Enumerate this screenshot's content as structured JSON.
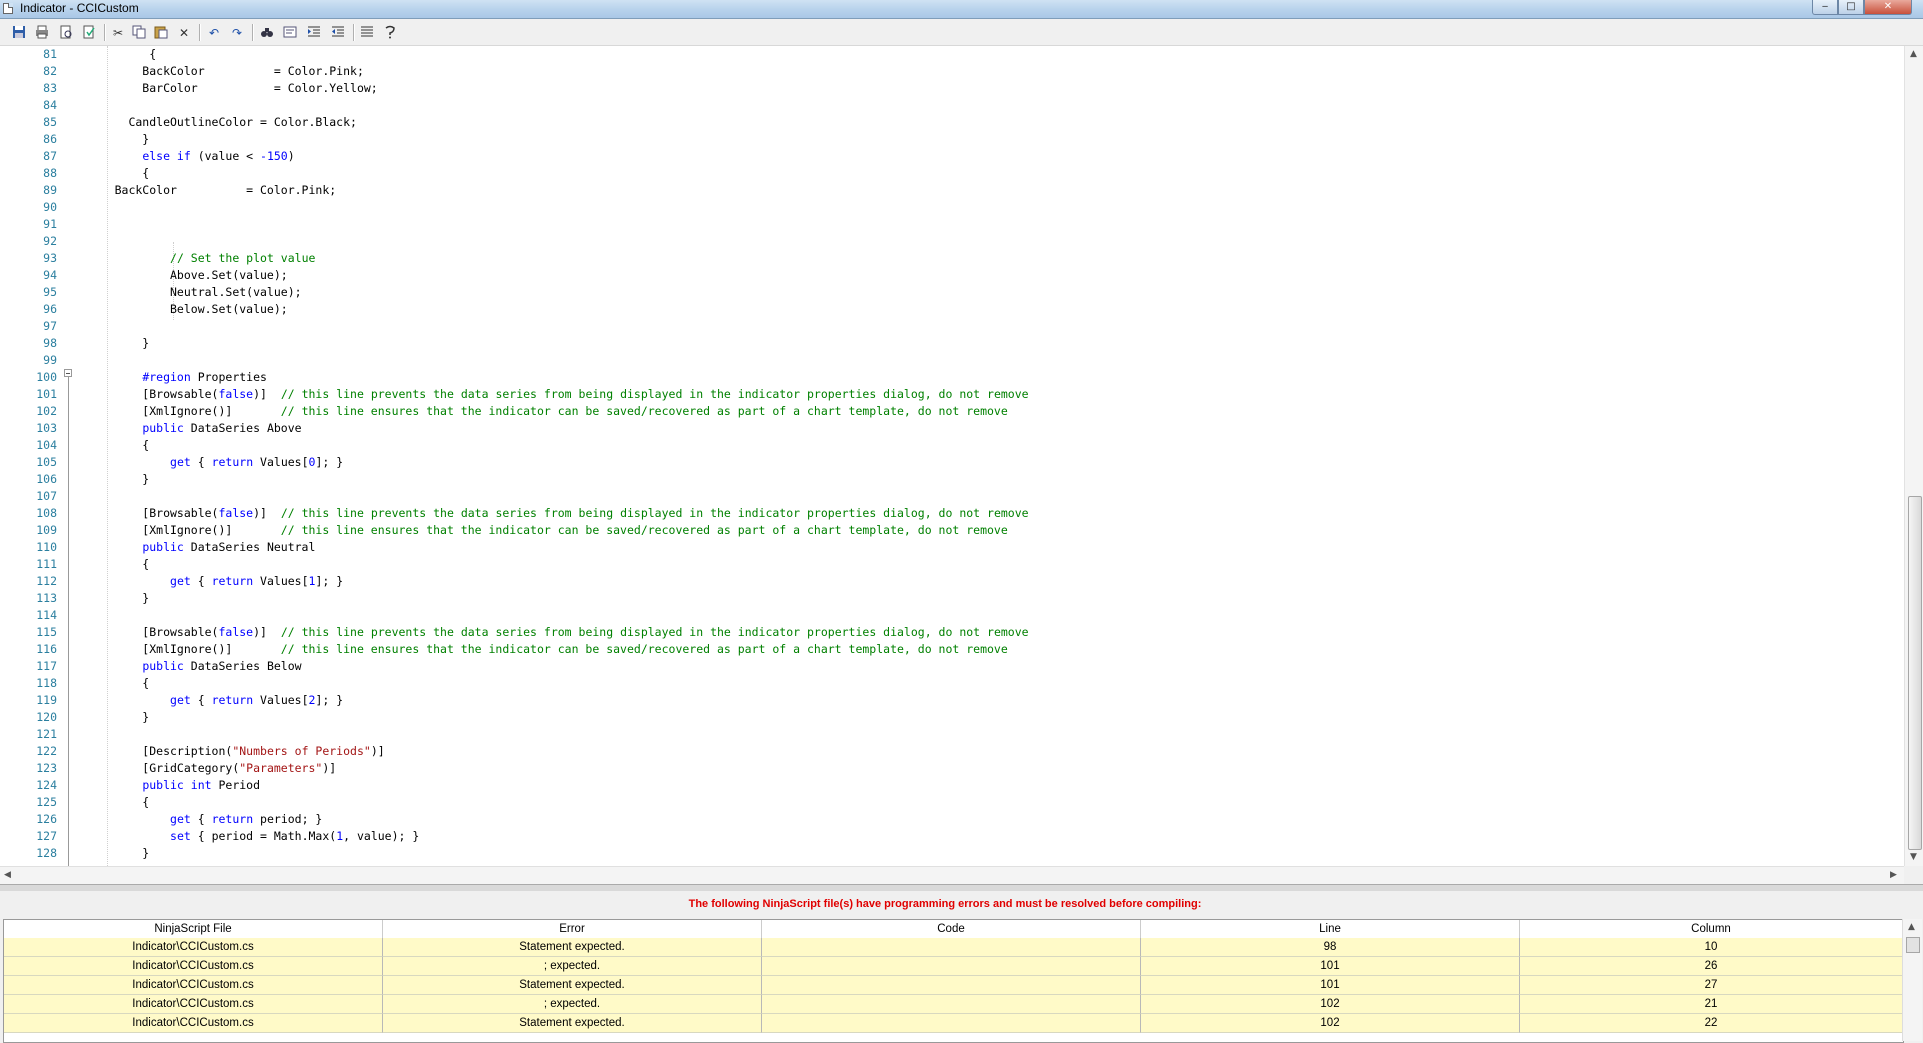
{
  "window": {
    "title": "Indicator - CCICustom",
    "controls": {
      "minimize": "‒",
      "maximize": "□",
      "close": "✕"
    }
  },
  "toolbar": {
    "icons": [
      "save-icon",
      "print-icon",
      "print-preview-icon",
      "page-setup-icon",
      "cut-icon",
      "copy-icon",
      "paste-icon",
      "delete-icon",
      "undo-icon",
      "redo-icon",
      "find-icon",
      "replace-icon",
      "indent-icon",
      "outdent-icon",
      "comment-icon",
      "uncomment-icon"
    ]
  },
  "editor": {
    "lines": [
      {
        "n": "81",
        "html": "          {"
      },
      {
        "n": "82",
        "html": "         BackColor          = Color.Pink;"
      },
      {
        "n": "83",
        "html": "         BarColor           = Color.Yellow;"
      },
      {
        "n": "84",
        "html": ""
      },
      {
        "n": "85",
        "html": "       CandleOutlineColor = Color.Black;"
      },
      {
        "n": "86",
        "html": "         }"
      },
      {
        "n": "87",
        "html": "         <span class=\"kw\">else if</span> (value &lt; <span class=\"num\">-150</span>)"
      },
      {
        "n": "88",
        "html": "         {"
      },
      {
        "n": "89",
        "html": "     BackColor          = Color.Pink;"
      },
      {
        "n": "90",
        "html": ""
      },
      {
        "n": "91",
        "html": ""
      },
      {
        "n": "92",
        "html": ""
      },
      {
        "n": "93",
        "html": "             <span class=\"cm\">// Set the plot value</span>"
      },
      {
        "n": "94",
        "html": "             Above.Set(value);"
      },
      {
        "n": "95",
        "html": "             Neutral.Set(value);"
      },
      {
        "n": "96",
        "html": "             Below.Set(value);"
      },
      {
        "n": "97",
        "html": ""
      },
      {
        "n": "98",
        "html": "         }"
      },
      {
        "n": "99",
        "html": ""
      },
      {
        "n": "100",
        "html": "         <span class=\"kw\">#region</span> Properties"
      },
      {
        "n": "101",
        "html": "         [Browsable(<span class=\"kw\">false</span>)]  <span class=\"cm\">// this line prevents the data series from being displayed in the indicator properties dialog, do not remove</span>"
      },
      {
        "n": "102",
        "html": "         [XmlIgnore()]       <span class=\"cm\">// this line ensures that the indicator can be saved/recovered as part of a chart template, do not remove</span>"
      },
      {
        "n": "103",
        "html": "         <span class=\"kw\">public</span> DataSeries Above"
      },
      {
        "n": "104",
        "html": "         {"
      },
      {
        "n": "105",
        "html": "             <span class=\"kw\">get</span> { <span class=\"kw\">return</span> Values[<span class=\"num\">0</span>]; }"
      },
      {
        "n": "106",
        "html": "         }"
      },
      {
        "n": "107",
        "html": ""
      },
      {
        "n": "108",
        "html": "         [Browsable(<span class=\"kw\">false</span>)]  <span class=\"cm\">// this line prevents the data series from being displayed in the indicator properties dialog, do not remove</span>"
      },
      {
        "n": "109",
        "html": "         [XmlIgnore()]       <span class=\"cm\">// this line ensures that the indicator can be saved/recovered as part of a chart template, do not remove</span>"
      },
      {
        "n": "110",
        "html": "         <span class=\"kw\">public</span> DataSeries Neutral"
      },
      {
        "n": "111",
        "html": "         {"
      },
      {
        "n": "112",
        "html": "             <span class=\"kw\">get</span> { <span class=\"kw\">return</span> Values[<span class=\"num\">1</span>]; }"
      },
      {
        "n": "113",
        "html": "         }"
      },
      {
        "n": "114",
        "html": ""
      },
      {
        "n": "115",
        "html": "         [Browsable(<span class=\"kw\">false</span>)]  <span class=\"cm\">// this line prevents the data series from being displayed in the indicator properties dialog, do not remove</span>"
      },
      {
        "n": "116",
        "html": "         [XmlIgnore()]       <span class=\"cm\">// this line ensures that the indicator can be saved/recovered as part of a chart template, do not remove</span>"
      },
      {
        "n": "117",
        "html": "         <span class=\"kw\">public</span> DataSeries Below"
      },
      {
        "n": "118",
        "html": "         {"
      },
      {
        "n": "119",
        "html": "             <span class=\"kw\">get</span> { <span class=\"kw\">return</span> Values[<span class=\"num\">2</span>]; }"
      },
      {
        "n": "120",
        "html": "         }"
      },
      {
        "n": "121",
        "html": ""
      },
      {
        "n": "122",
        "html": "         [Description(<span class=\"str\">\"Numbers of Periods\"</span>)]"
      },
      {
        "n": "123",
        "html": "         [GridCategory(<span class=\"str\">\"Parameters\"</span>)]"
      },
      {
        "n": "124",
        "html": "         <span class=\"kw\">public int</span> Period"
      },
      {
        "n": "125",
        "html": "         {"
      },
      {
        "n": "126",
        "html": "             <span class=\"kw\">get</span> { <span class=\"kw\">return</span> period; }"
      },
      {
        "n": "127",
        "html": "             <span class=\"kw\">set</span> { period = Math.Max(<span class=\"num\">1</span>, value); }"
      },
      {
        "n": "128",
        "html": "         }"
      }
    ]
  },
  "errors": {
    "message": "The following NinjaScript file(s) have programming errors and must be resolved before compiling:",
    "columns": [
      "NinjaScript File",
      "Error",
      "Code",
      "Line",
      "Column"
    ],
    "rows": [
      [
        "Indicator\\CCICustom.cs",
        "Statement expected.",
        "",
        "98",
        "10"
      ],
      [
        "Indicator\\CCICustom.cs",
        "; expected.",
        "",
        "101",
        "26"
      ],
      [
        "Indicator\\CCICustom.cs",
        "Statement expected.",
        "",
        "101",
        "27"
      ],
      [
        "Indicator\\CCICustom.cs",
        "; expected.",
        "",
        "102",
        "21"
      ],
      [
        "Indicator\\CCICustom.cs",
        "Statement expected.",
        "",
        "102",
        "22"
      ]
    ]
  }
}
